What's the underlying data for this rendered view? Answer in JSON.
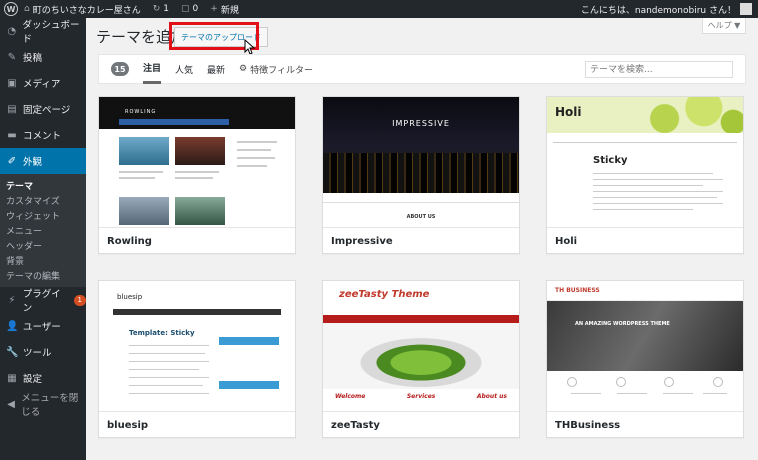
{
  "adminbar": {
    "site_name": "町のちいさなカレー屋さん",
    "updates_count": "1",
    "comments_count": "0",
    "new_label": "新規",
    "greeting": "こんにちは、nandemonobiru さん！"
  },
  "sidebar": {
    "items": [
      {
        "label": "ダッシュボード",
        "icon": "dashboard-icon"
      },
      {
        "label": "投稿",
        "icon": "pin-icon"
      },
      {
        "label": "メディア",
        "icon": "media-icon"
      },
      {
        "label": "固定ページ",
        "icon": "page-icon"
      },
      {
        "label": "コメント",
        "icon": "comment-icon"
      },
      {
        "label": "外観",
        "icon": "brush-icon"
      }
    ],
    "submenu": [
      "テーマ",
      "カスタマイズ",
      "ウィジェット",
      "メニュー",
      "ヘッダー",
      "背景",
      "テーマの編集"
    ],
    "items2": [
      {
        "label": "プラグイン",
        "icon": "plugin-icon",
        "badge": "1"
      },
      {
        "label": "ユーザー",
        "icon": "user-icon"
      },
      {
        "label": "ツール",
        "icon": "wrench-icon"
      },
      {
        "label": "設定",
        "icon": "settings-icon"
      }
    ],
    "collapse_label": "メニューを閉じる"
  },
  "header": {
    "title": "テーマを追加",
    "upload_label": "テーマのアップロード",
    "help_label": "ヘルプ ▼"
  },
  "filter": {
    "count": "15",
    "featured": "注目",
    "popular": "人気",
    "latest": "最新",
    "feature_filter": "特徴フィルター",
    "search_placeholder": "テーマを検索..."
  },
  "themes": [
    {
      "name": "Rowling"
    },
    {
      "name": "Impressive"
    },
    {
      "name": "Holi"
    },
    {
      "name": "bluesip"
    },
    {
      "name": "zeeTasty"
    },
    {
      "name": "THBusiness"
    }
  ],
  "screens": {
    "rowling_logo": "ROWLING",
    "impressive_title": "IMPRESSIVE",
    "impressive_about": "ABOUT US",
    "holi_logo": "Holi",
    "holi_sticky": "Sticky",
    "bluesip_logo": "bluesip",
    "bluesip_title": "Template: Sticky",
    "zee_logo": "zeeTasty Theme",
    "zee_cols": [
      "Welcome",
      "Services",
      "About us"
    ],
    "thb_logo": "TH BUSINESS",
    "thb_hero": "AN AMAZING WORDPRESS THEME"
  }
}
